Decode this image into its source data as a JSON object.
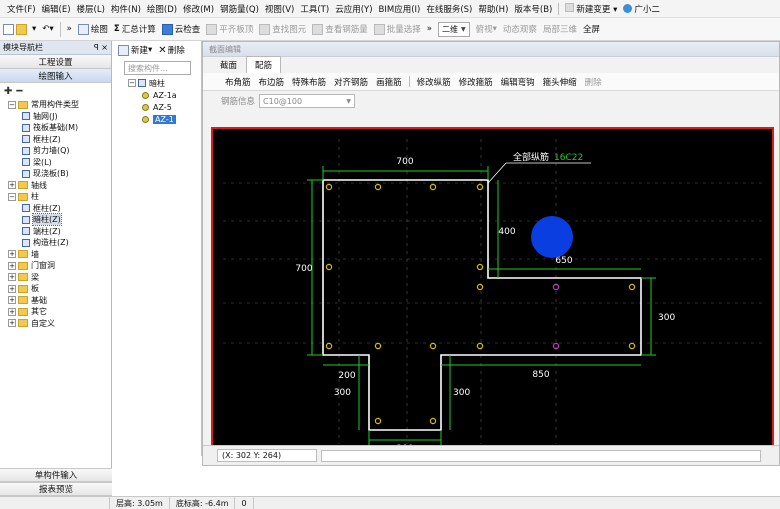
{
  "menu": {
    "items": [
      "文件(F)",
      "编辑(E)",
      "楼层(L)",
      "构件(N)",
      "绘图(D)",
      "修改(M)",
      "钢筋量(Q)",
      "视图(V)",
      "工具(T)",
      "云应用(Y)",
      "BIM应用(I)",
      "在线服务(S)",
      "帮助(H)",
      "版本号(B)"
    ],
    "new_change": "新建变更",
    "user": "广小二"
  },
  "toolbar": {
    "draw": "绘图",
    "sum_calc": "汇总计算",
    "cloud_check": "云检查",
    "flat_slab": "平齐板顶",
    "find_element": "查找图元",
    "view_rebar": "查看钢筋量",
    "batch_select": "批量选择",
    "view_select": "二维",
    "view_top": "俯视",
    "dynamic_view": "动态观察",
    "local_3d": "局部三维",
    "full_screen": "全屏"
  },
  "nav": {
    "title": "模块导航栏",
    "pin": "ꟼ ×",
    "project_settings": "工程设置",
    "drawing_input": "绘图输入",
    "tree": [
      {
        "label": "常用构件类型",
        "level": 0,
        "type": "folder",
        "expander": "−"
      },
      {
        "label": "轴网(J)",
        "level": 1,
        "type": "leaf"
      },
      {
        "label": "筏板基础(M)",
        "level": 1,
        "type": "leaf"
      },
      {
        "label": "框柱(Z)",
        "level": 1,
        "type": "leaf"
      },
      {
        "label": "剪力墙(Q)",
        "level": 1,
        "type": "leaf"
      },
      {
        "label": "梁(L)",
        "level": 1,
        "type": "leaf"
      },
      {
        "label": "现浇板(B)",
        "level": 1,
        "type": "leaf"
      },
      {
        "label": "轴线",
        "level": 0,
        "type": "folder",
        "expander": "+"
      },
      {
        "label": "柱",
        "level": 0,
        "type": "folder",
        "expander": "−"
      },
      {
        "label": "框柱(Z)",
        "level": 1,
        "type": "leaf"
      },
      {
        "label": "暗柱(Z)",
        "level": 1,
        "type": "leaf",
        "selected": true
      },
      {
        "label": "端柱(Z)",
        "level": 1,
        "type": "leaf"
      },
      {
        "label": "构造柱(Z)",
        "level": 1,
        "type": "leaf"
      },
      {
        "label": "墙",
        "level": 0,
        "type": "folder",
        "expander": "+"
      },
      {
        "label": "门窗洞",
        "level": 0,
        "type": "folder",
        "expander": "+"
      },
      {
        "label": "梁",
        "level": 0,
        "type": "folder",
        "expander": "+"
      },
      {
        "label": "板",
        "level": 0,
        "type": "folder",
        "expander": "+"
      },
      {
        "label": "基础",
        "level": 0,
        "type": "folder",
        "expander": "+"
      },
      {
        "label": "其它",
        "level": 0,
        "type": "folder",
        "expander": "+"
      },
      {
        "label": "自定义",
        "level": 0,
        "type": "folder",
        "expander": "+"
      }
    ],
    "single_input": "单构件输入",
    "report_preview": "报表预览"
  },
  "panel2": {
    "new": "新建",
    "delete": "删除",
    "search_placeholder": "搜索构件...",
    "root": "暗柱",
    "items": [
      {
        "label": "AZ-1a"
      },
      {
        "label": "AZ-5"
      },
      {
        "label": "AZ-1",
        "selected": true
      }
    ]
  },
  "dialog": {
    "title": "截面编辑",
    "tabs": [
      "截面",
      "配筋"
    ],
    "active_tab": 1,
    "tools": [
      "布角筋",
      "布边筋",
      "特殊布筋",
      "对齐钢筋",
      "画箍筋",
      "修改纵筋",
      "修改箍筋",
      "编辑弯钩",
      "箍头伸缩",
      "删除"
    ],
    "rebar_label": "钢筋信息",
    "rebar_value": "C10@100",
    "coords": "(X: 302 Y: 264)"
  },
  "drawing": {
    "dim_700_top": "700",
    "dim_700_left": "700",
    "dim_400": "400",
    "dim_650": "650",
    "dim_300_right": "300",
    "dim_200": "200",
    "dim_300_left": "300",
    "dim_300_mid": "300",
    "dim_850": "850",
    "dim_300_bottom": "300",
    "label_prefix": "全部纵筋",
    "label_spec": "16C22",
    "colors": {
      "outline": "#ffffff",
      "dimension": "#22cc22",
      "rebar": "#d8c000",
      "rebar_highlight": "#c040c0",
      "grid": "#5a5a5a",
      "spec": "#22cc22"
    }
  },
  "status": {
    "floor_height": "层高: 3.05m",
    "bottom_elev": "底标高: -6.4m",
    "zero": "0"
  }
}
